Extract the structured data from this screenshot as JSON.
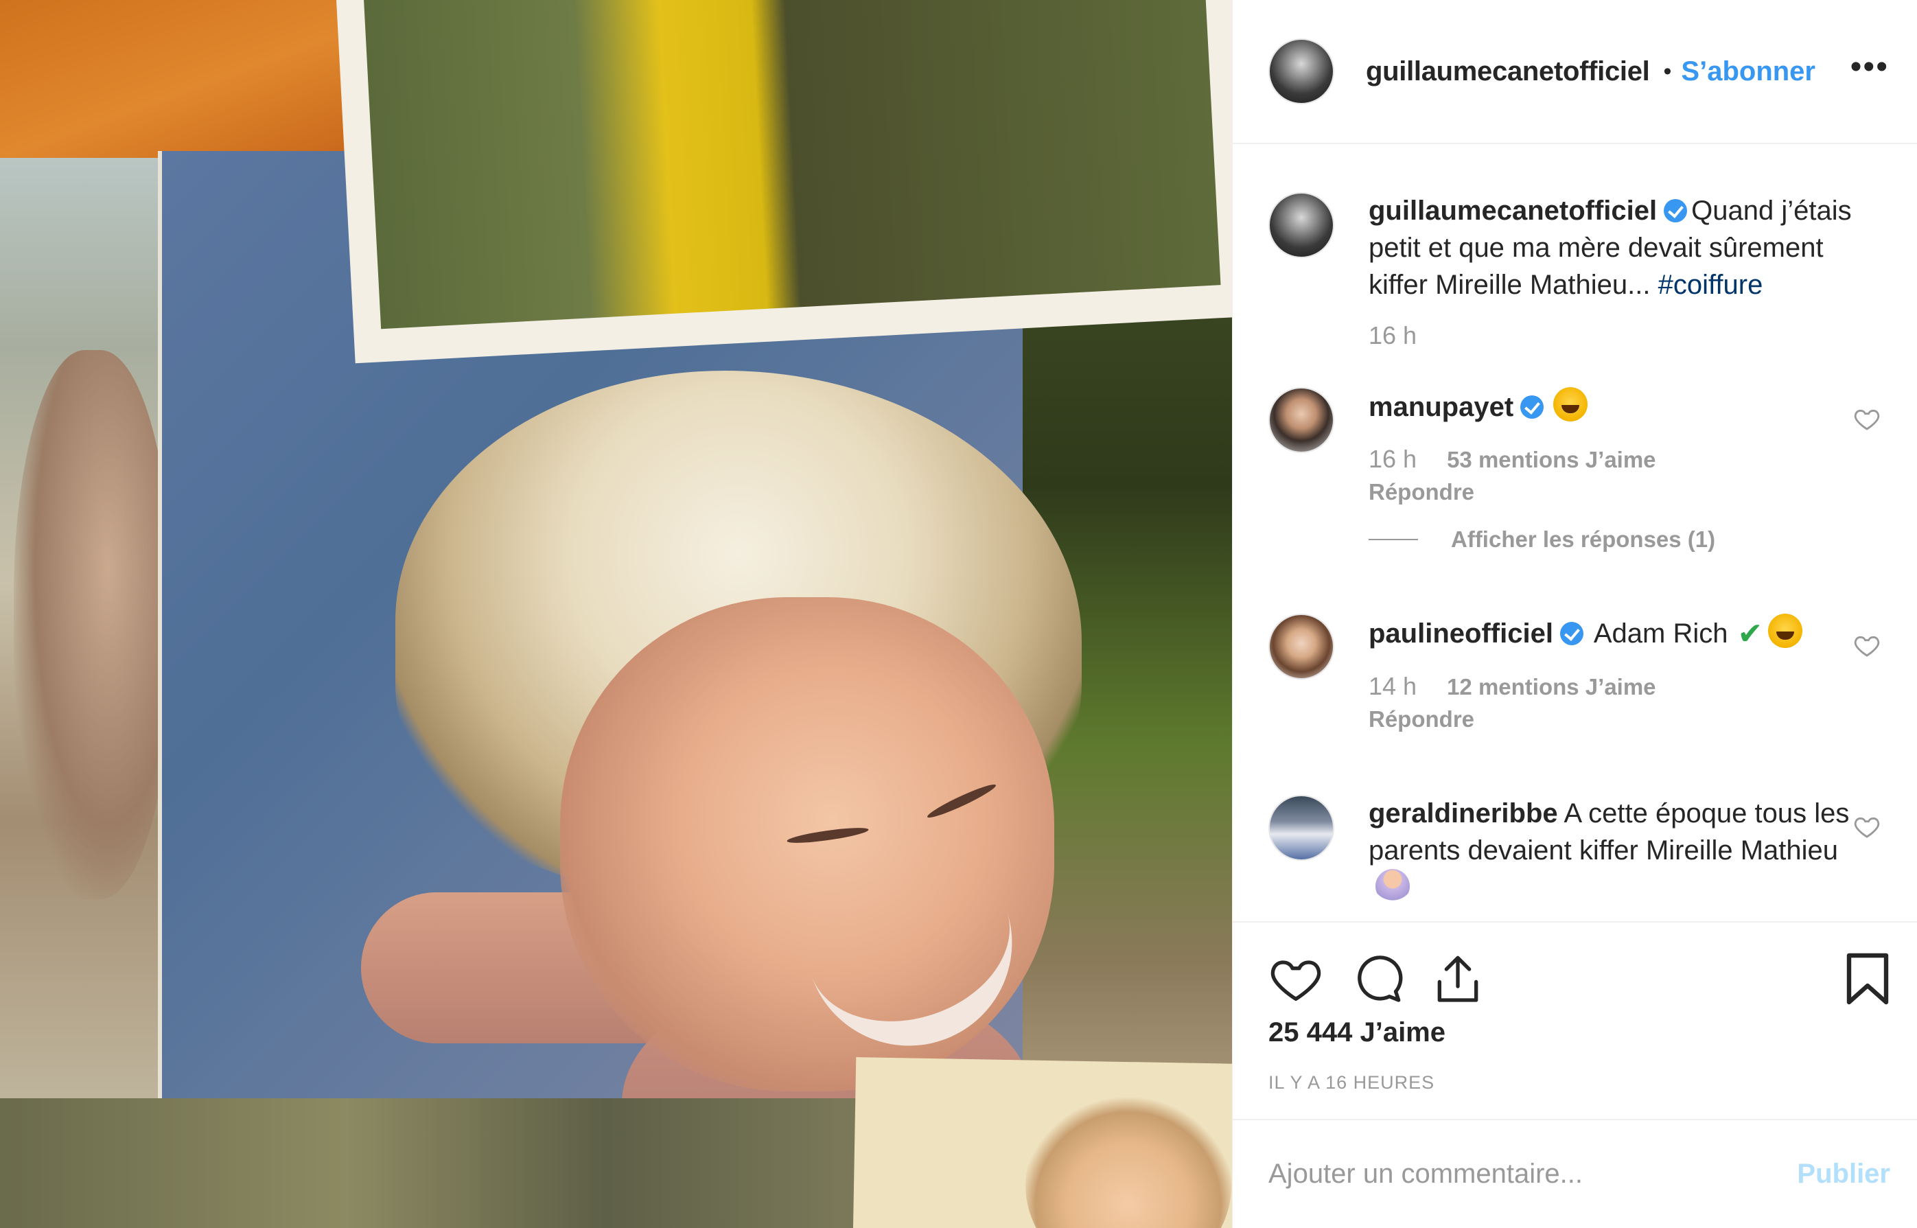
{
  "header": {
    "username": "guillaumecanetofficiel",
    "separator": "•",
    "follow_label": "S’abonner",
    "more_label": "•••"
  },
  "caption": {
    "username": "guillaumecanetofficiel",
    "text": "Quand j’étais petit et que ma mère devait sûrement kiffer Mireille Mathieu...",
    "hashtag": "#coiffure",
    "time": "16 h"
  },
  "comments": [
    {
      "username": "manupayet",
      "verified": true,
      "text": "",
      "emoji": "laughing-emoji",
      "time": "16 h",
      "likes": "53 mentions J’aime",
      "reply": "Répondre",
      "view_replies": "Afficher les réponses (1)"
    },
    {
      "username": "paulineofficiel",
      "verified": true,
      "text": "Adam Rich",
      "emoji": "grinning-emoji",
      "time": "14 h",
      "likes": "12 mentions J’aime",
      "reply": "Répondre"
    },
    {
      "username": "geraldineribbe",
      "verified": false,
      "text": "A cette époque tous les parents devaient kiffer Mireille Mathieu",
      "emoji": "shrug-emoji"
    }
  ],
  "actions": {
    "likes_total": "25 444 J’aime",
    "time_ago": "IL Y A 16 HEURES"
  },
  "composer": {
    "placeholder": "Ajouter un commentaire...",
    "publish_label": "Publier"
  },
  "colors": {
    "accent": "#3897f0",
    "muted": "#999999",
    "hashtag": "#003569",
    "publish_disabled": "#b2dffc"
  }
}
